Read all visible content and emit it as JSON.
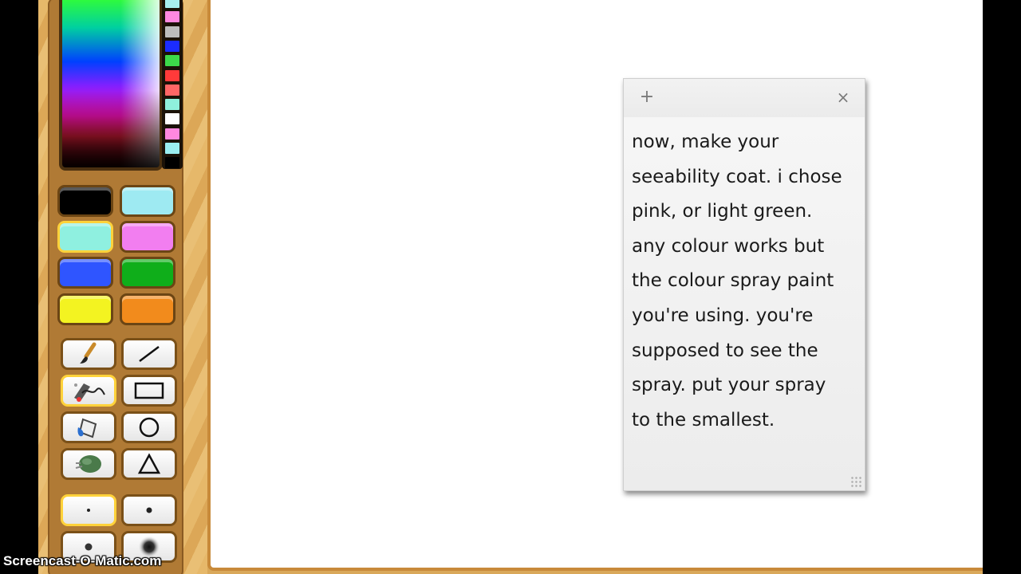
{
  "app": {
    "palette": {
      "strip_colors": [
        "#a8f0f0",
        "#ff88e0",
        "#bdbdbd",
        "#1b2cff",
        "#3cd94a",
        "#ff3a3a",
        "#ff6666",
        "#8ff0dc",
        "#ffffff",
        "#ff88e0",
        "#9aeef0",
        "#000000"
      ],
      "color_buttons": [
        {
          "name": "black",
          "color": "#000000",
          "selected": false
        },
        {
          "name": "light-cyan",
          "color": "#9eeaf2",
          "selected": false
        },
        {
          "name": "aqua",
          "color": "#8ff0e0",
          "selected": true
        },
        {
          "name": "pink",
          "color": "#f27ef0",
          "selected": false
        },
        {
          "name": "blue",
          "color": "#2f55ff",
          "selected": false
        },
        {
          "name": "green",
          "color": "#0fae1a",
          "selected": false
        },
        {
          "name": "yellow",
          "color": "#f3f321",
          "selected": false
        },
        {
          "name": "orange",
          "color": "#f28b1c",
          "selected": false
        }
      ]
    },
    "tools": [
      {
        "name": "paintbrush",
        "icon": "paintbrush-icon",
        "selected": false
      },
      {
        "name": "line",
        "icon": "line-icon",
        "selected": false
      },
      {
        "name": "spray-paint",
        "icon": "spray-paint-icon",
        "selected": true
      },
      {
        "name": "rectangle",
        "icon": "rectangle-icon",
        "selected": false
      },
      {
        "name": "paint-bucket",
        "icon": "paint-bucket-icon",
        "selected": false
      },
      {
        "name": "circle",
        "icon": "circle-icon",
        "selected": false
      },
      {
        "name": "stamp",
        "icon": "stamp-icon",
        "selected": false
      },
      {
        "name": "triangle",
        "icon": "triangle-icon",
        "selected": false
      }
    ],
    "brush_sizes": [
      {
        "name": "size-smallest",
        "selected": true
      },
      {
        "name": "size-small",
        "selected": false
      },
      {
        "name": "size-medium",
        "selected": false
      },
      {
        "name": "size-soft-large",
        "selected": false
      }
    ]
  },
  "sticky_note": {
    "add_symbol": "+",
    "close_symbol": "×",
    "text": "now, make your\nseeability coat. i chose\npink, or light green.\nany colour works but\nthe colour spray paint\nyou're using. you're\nsupposed to see the\nspray. put your spray\nto the smallest."
  },
  "watermark": {
    "text": "Screencast-O-Matic.com"
  }
}
